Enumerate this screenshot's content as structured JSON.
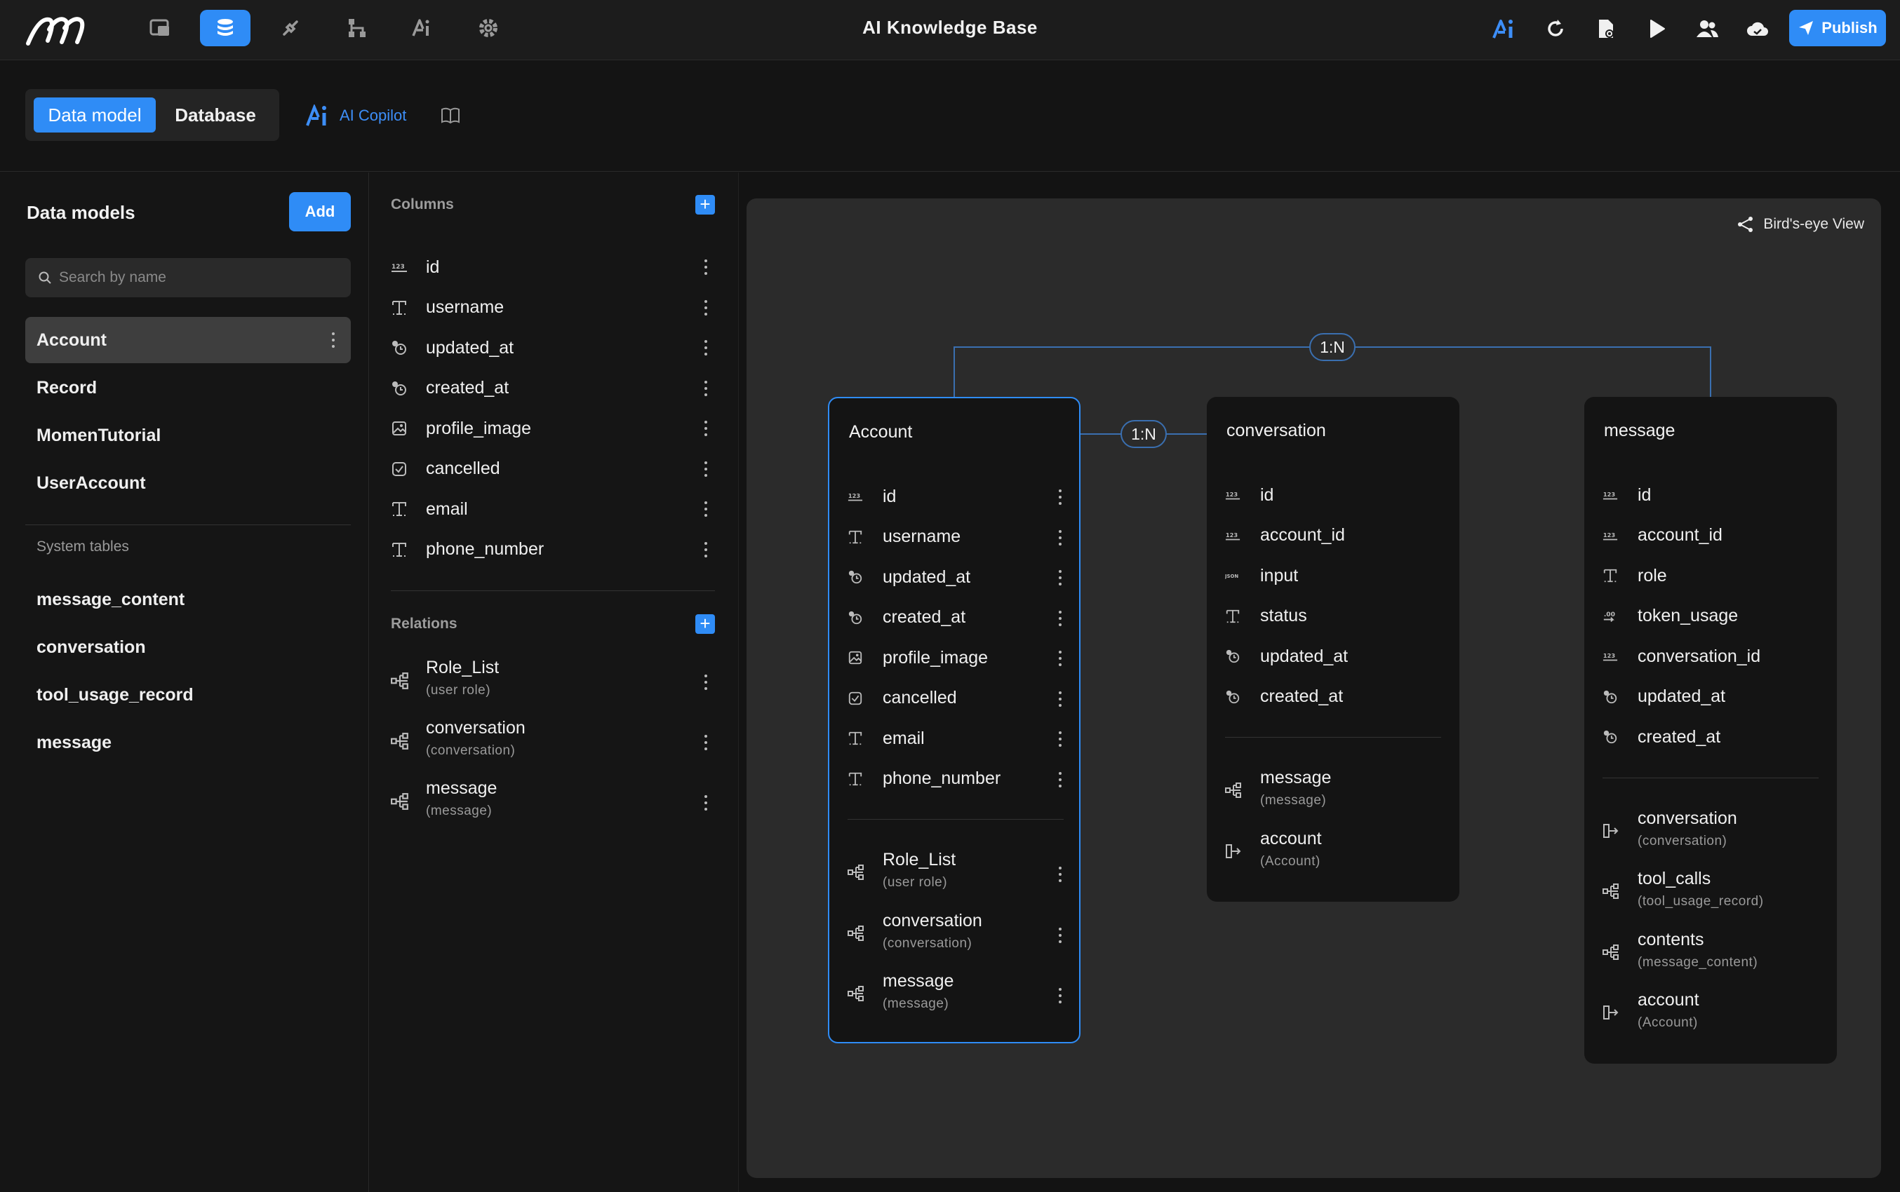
{
  "app": {
    "title": "AI Knowledge Base",
    "publish_label": "Publish",
    "accent": "#2f8cf6"
  },
  "nav_icons": [
    "pages-icon",
    "database-icon",
    "plugins-icon",
    "workflow-icon",
    "ai-icon",
    "settings-icon"
  ],
  "right_icons": [
    "ai-assistant-icon",
    "refresh-icon",
    "file-settings-icon",
    "preview-play-icon",
    "users-icon",
    "cloud-icon"
  ],
  "subheader": {
    "tabs": [
      "Data model",
      "Database"
    ],
    "active_tab": "Data model",
    "copilot_label": "AI Copilot"
  },
  "left": {
    "title": "Data models",
    "add_label": "Add",
    "search_placeholder": "Search by name",
    "models": [
      "Account",
      "Record",
      "MomenTutorial",
      "UserAccount"
    ],
    "selected": "Account",
    "system_label": "System tables",
    "system_tables": [
      "message_content",
      "conversation",
      "tool_usage_record",
      "message"
    ]
  },
  "columns_panel": {
    "columns_label": "Columns",
    "columns": [
      {
        "name": "id",
        "type": "integer"
      },
      {
        "name": "username",
        "type": "text"
      },
      {
        "name": "updated_at",
        "type": "datetime"
      },
      {
        "name": "created_at",
        "type": "datetime"
      },
      {
        "name": "profile_image",
        "type": "image"
      },
      {
        "name": "cancelled",
        "type": "boolean"
      },
      {
        "name": "email",
        "type": "text"
      },
      {
        "name": "phone_number",
        "type": "text"
      }
    ],
    "relations_label": "Relations",
    "relations": [
      {
        "name": "Role_List",
        "target": "(user role)"
      },
      {
        "name": "conversation",
        "target": "(conversation)"
      },
      {
        "name": "message",
        "target": "(message)"
      }
    ]
  },
  "canvas": {
    "birds_eye_label": "Bird's-eye View",
    "badges": [
      "1:N",
      "1:N"
    ],
    "tables": [
      {
        "name": "Account",
        "columns": [
          {
            "name": "id",
            "type": "integer"
          },
          {
            "name": "username",
            "type": "text"
          },
          {
            "name": "updated_at",
            "type": "datetime"
          },
          {
            "name": "created_at",
            "type": "datetime"
          },
          {
            "name": "profile_image",
            "type": "image"
          },
          {
            "name": "cancelled",
            "type": "boolean"
          },
          {
            "name": "email",
            "type": "text"
          },
          {
            "name": "phone_number",
            "type": "text"
          }
        ],
        "relations": [
          {
            "name": "Role_List",
            "target": "(user role)",
            "kind": "many"
          },
          {
            "name": "conversation",
            "target": "(conversation)",
            "kind": "many"
          },
          {
            "name": "message",
            "target": "(message)",
            "kind": "many"
          }
        ]
      },
      {
        "name": "conversation",
        "columns": [
          {
            "name": "id",
            "type": "integer"
          },
          {
            "name": "account_id",
            "type": "integer"
          },
          {
            "name": "input",
            "type": "json"
          },
          {
            "name": "status",
            "type": "text"
          },
          {
            "name": "updated_at",
            "type": "datetime"
          },
          {
            "name": "created_at",
            "type": "datetime"
          }
        ],
        "relations": [
          {
            "name": "message",
            "target": "(message)",
            "kind": "many"
          },
          {
            "name": "account",
            "target": "(Account)",
            "kind": "one"
          }
        ]
      },
      {
        "name": "message",
        "columns": [
          {
            "name": "id",
            "type": "integer"
          },
          {
            "name": "account_id",
            "type": "integer"
          },
          {
            "name": "role",
            "type": "text"
          },
          {
            "name": "token_usage",
            "type": "decimal"
          },
          {
            "name": "conversation_id",
            "type": "integer"
          },
          {
            "name": "updated_at",
            "type": "datetime"
          },
          {
            "name": "created_at",
            "type": "datetime"
          }
        ],
        "relations": [
          {
            "name": "conversation",
            "target": "(conversation)",
            "kind": "one"
          },
          {
            "name": "tool_calls",
            "target": "(tool_usage_record)",
            "kind": "many"
          },
          {
            "name": "contents",
            "target": "(message_content)",
            "kind": "many"
          },
          {
            "name": "account",
            "target": "(Account)",
            "kind": "one"
          }
        ]
      }
    ]
  }
}
